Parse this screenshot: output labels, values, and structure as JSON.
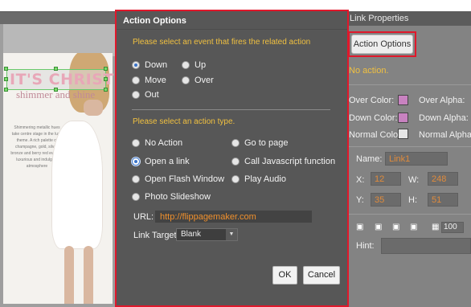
{
  "canvas": {
    "headline": "IT'S CHRISTMAS",
    "subtitle": "shimmer and shine",
    "blurb": "Shimmering metallic hues take centre stage in the luxe theme. A rich palette of champagne, gold, silver, bronze and berry red evoke a luxurious and indulgent atmosphere"
  },
  "properties_panel": {
    "title": "Link Properties",
    "action_button_label": "Action Options",
    "status_text": "No action.",
    "over_color_label": "Over Color:",
    "over_alpha_label": "Over Alpha:",
    "down_color_label": "Down Color:",
    "down_alpha_label": "Down Alpha:",
    "normal_color_label": "Normal Color:",
    "normal_alpha_label": "Normal Alpha:",
    "name_label": "Name:",
    "name_value": "Link1",
    "x_label": "X:",
    "x_value": "12",
    "w_label": "W:",
    "w_value": "248",
    "y_label": "Y:",
    "y_value": "35",
    "h_label": "H:",
    "h_value": "51",
    "zoom_value": "100",
    "hint_label": "Hint:",
    "colors": {
      "over": "#c882c0",
      "down": "#c882c0",
      "normal": "#e6e6e6"
    }
  },
  "dialog": {
    "title": "Action Options",
    "event_instruction": "Please select an event that fires the related action",
    "events": [
      {
        "label": "Down",
        "selected": true
      },
      {
        "label": "Up",
        "selected": false
      },
      {
        "label": "Move",
        "selected": false
      },
      {
        "label": "Over",
        "selected": false
      },
      {
        "label": "Out",
        "selected": false
      }
    ],
    "action_instruction": "Please select an action type.",
    "actions": [
      {
        "label": "No Action",
        "selected": false
      },
      {
        "label": "Go to page",
        "selected": false
      },
      {
        "label": "Open a link",
        "selected": true
      },
      {
        "label": "Call Javascript function",
        "selected": false
      },
      {
        "label": "Open Flash Window",
        "selected": false
      },
      {
        "label": "Play Audio",
        "selected": false
      },
      {
        "label": "Photo Slideshow",
        "selected": false
      }
    ],
    "url_label": "URL:",
    "url_value": "http://flippagemaker.com",
    "link_target_label": "Link Target:",
    "link_target_value": "Blank",
    "ok_label": "OK",
    "cancel_label": "Cancel"
  }
}
